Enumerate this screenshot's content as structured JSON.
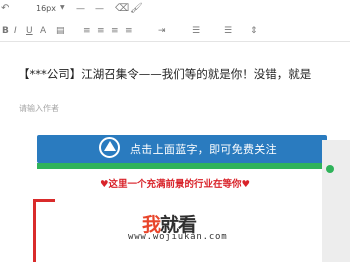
{
  "toolbar": {
    "font_size": "16px",
    "icons_row1": [
      "undo-icon",
      "caret-down-icon",
      "horizontal-rule-icon",
      "horizontal-rule-icon",
      "eraser-icon",
      "format-brush-icon"
    ],
    "icons_row2": [
      "bold-icon",
      "italic-icon",
      "underline-icon",
      "text-color-icon",
      "background-color-icon",
      "align-left-icon",
      "align-center-icon",
      "align-right-icon",
      "align-justify-icon",
      "indent-icon",
      "ordered-list-icon",
      "unordered-list-icon",
      "line-height-icon"
    ]
  },
  "article": {
    "title": "【***公司】江湖召集令——我们等的就是你！没错，就是",
    "author_placeholder": "请输入作者"
  },
  "banner": {
    "text": "点击上面蓝字，即可免费关注",
    "color": "#2a7bbf",
    "accent": "#2fb35a"
  },
  "tagline": "♥这里一个充满前景的行业在等你♥",
  "watermark": {
    "brand_part1": "我",
    "brand_part2": "就看",
    "url": "www.wojiukan.com"
  }
}
